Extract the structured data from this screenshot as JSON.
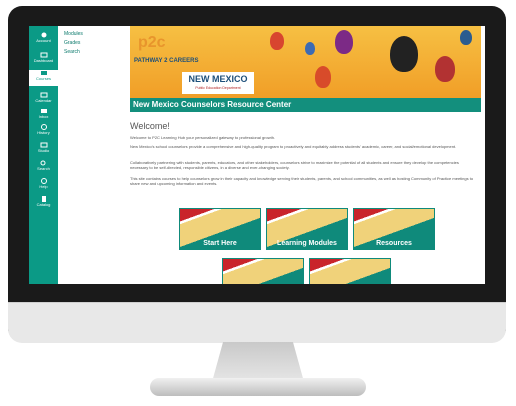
{
  "global_nav": [
    {
      "label": "Account",
      "icon": "account-icon"
    },
    {
      "label": "Dashboard",
      "icon": "dashboard-icon"
    },
    {
      "label": "Courses",
      "icon": "courses-icon"
    },
    {
      "label": "Calendar",
      "icon": "calendar-icon"
    },
    {
      "label": "Inbox",
      "icon": "inbox-icon"
    },
    {
      "label": "History",
      "icon": "history-icon"
    },
    {
      "label": "Studio",
      "icon": "studio-icon"
    },
    {
      "label": "Search",
      "icon": "search-icon"
    },
    {
      "label": "Help",
      "icon": "help-icon"
    },
    {
      "label": "Catalog",
      "icon": "catalog-icon"
    }
  ],
  "course_nav": [
    "Modules",
    "Grades",
    "Search"
  ],
  "banner": {
    "p2c": "p2c",
    "p2c_sub": "PATHWAY 2 CAREERS",
    "nm": "NEW MEXICO",
    "nm_sub": "Public Education Department"
  },
  "title": "New Mexico Counselors Resource Center",
  "welcome": "Welcome!",
  "paragraphs": [
    "Welcome to P2C Learning Hub your personalized gateway to professional growth.",
    "New Mexico's school counselors provide a comprehensive and high-quality program to proactively and equitably address students' academic, career, and social/emotional development.",
    "Collaboratively partnering with students, parents, educators, and other stakeholders, counselors strive to maximize the potential of all students and ensure they develop the competencies necessary to be self-directed, responsible citizens, in a diverse and ever-changing society.",
    "This site contains courses to help counselors grow in their capacity and knowledge serving their students, parents, and school communities, as well as hosting Community of Practice meetings to share new and upcoming information and events."
  ],
  "tiles": [
    "Start Here",
    "Learning Modules",
    "Resources",
    "",
    ""
  ],
  "colors": {
    "teal": "#0b9a86",
    "red": "#c9242a",
    "gold": "#f0d27a"
  }
}
